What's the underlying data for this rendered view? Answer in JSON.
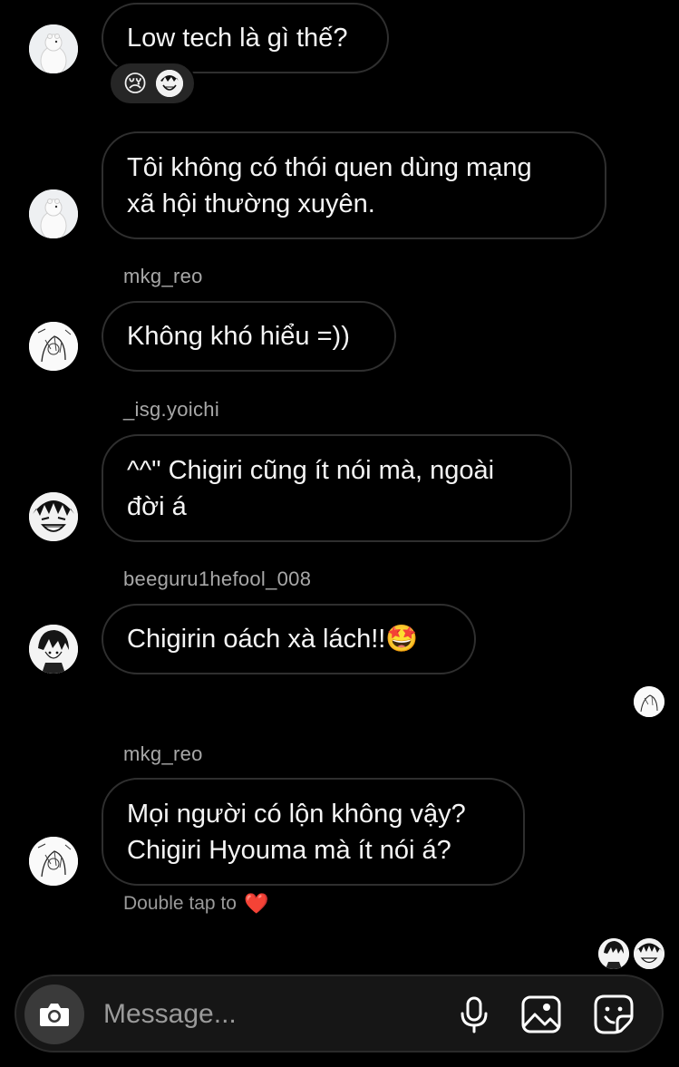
{
  "messages": [
    {
      "text": "Low tech là gì thế?",
      "avatar": "polar-bear-avatar"
    },
    {
      "text": "Tôi không có thói quen dùng mạng\nxã hội thường xuyên.",
      "avatar": "polar-bear-avatar"
    },
    {
      "username": "mkg_reo",
      "text": "Không khó hiểu =))",
      "avatar": "sketch-avatar"
    },
    {
      "username": "_isg.yoichi",
      "text": "^^\" Chigiri cũng ít nói mà, ngoài\nđời á",
      "avatar": "manga-face-avatar"
    },
    {
      "username": "beeguru1hefool_008",
      "text": "Chigirin oách xà lách!!🤩",
      "avatar": "dark-hair-avatar"
    },
    {
      "username": "mkg_reo",
      "text": "Mọi người có lộn không vậy?\nChigiri Hyouma mà ít nói á?",
      "avatar": "sketch-avatar"
    }
  ],
  "reactions": {
    "emoji": "😢",
    "icons": [
      "crying-emoji-icon",
      "reactor-avatar"
    ]
  },
  "double_tap": {
    "label": "Double tap to",
    "emoji": "❤️"
  },
  "composer": {
    "placeholder": "Message...",
    "icons": [
      "camera-icon",
      "microphone-icon",
      "gallery-icon",
      "sticker-icon"
    ]
  },
  "colors": {
    "background": "#000000",
    "bubble_border": "#2f2f2f",
    "composer_bg": "#161616",
    "camera_bg": "#3a3a3a",
    "secondary_text": "#a8a8a8"
  }
}
